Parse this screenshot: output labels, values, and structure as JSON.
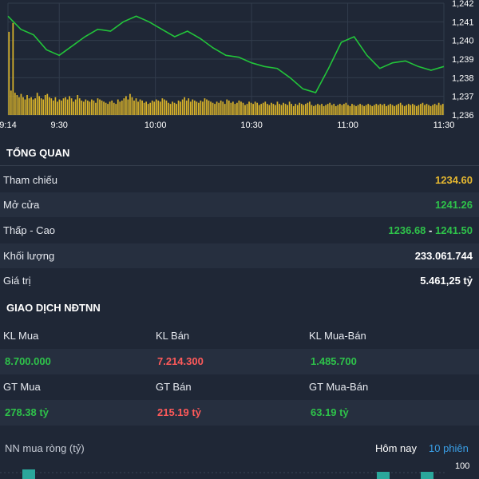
{
  "chart_data": {
    "type": "line+bar",
    "x_ticks": [
      "9:14",
      "9:30",
      "10:00",
      "10:30",
      "11:00",
      "11:30"
    ],
    "y_ticks": [
      "1,242",
      "1,241",
      "1,240",
      "1,239",
      "1,238",
      "1,237",
      "1,236"
    ],
    "ylim": [
      1236,
      1242
    ],
    "price_series": {
      "color": "#22c43a",
      "x_minutes": [
        0,
        4,
        8,
        12,
        16,
        20,
        24,
        28,
        32,
        36,
        40,
        44,
        48,
        52,
        56,
        60,
        64,
        68,
        72,
        76,
        80,
        84,
        88,
        92,
        96,
        100,
        104,
        108,
        112,
        116,
        120,
        124,
        128,
        132,
        136
      ],
      "values": [
        1241.3,
        1240.6,
        1240.3,
        1239.5,
        1239.2,
        1239.7,
        1240.2,
        1240.6,
        1240.5,
        1241.0,
        1241.3,
        1241.0,
        1240.6,
        1240.2,
        1240.5,
        1240.1,
        1239.6,
        1239.2,
        1239.1,
        1238.8,
        1238.6,
        1238.5,
        1238.0,
        1237.4,
        1237.2,
        1238.5,
        1239.9,
        1240.2,
        1239.2,
        1238.5,
        1238.8,
        1238.9,
        1238.6,
        1238.4,
        1238.6
      ]
    },
    "volume_series": {
      "color": "#d9b32a",
      "bars": [
        7.5,
        2.2,
        8.3,
        2.0,
        1.8,
        1.6,
        1.9,
        1.6,
        1.4,
        1.8,
        1.5,
        1.6,
        1.4,
        1.5,
        2.0,
        1.7,
        1.5,
        1.4,
        1.8,
        1.9,
        1.6,
        1.5,
        1.3,
        1.6,
        1.2,
        1.4,
        1.3,
        1.5,
        1.6,
        1.4,
        1.7,
        1.5,
        1.2,
        1.4,
        1.8,
        1.5,
        1.3,
        1.2,
        1.4,
        1.3,
        1.2,
        1.4,
        1.3,
        1.1,
        1.5,
        1.4,
        1.3,
        1.2,
        1.1,
        1.0,
        1.2,
        1.3,
        1.1,
        1.0,
        1.4,
        1.2,
        1.3,
        1.5,
        1.7,
        1.4,
        1.9,
        1.6,
        1.3,
        1.5,
        1.2,
        1.4,
        1.3,
        1.1,
        1.2,
        1.0,
        1.1,
        1.3,
        1.2,
        1.4,
        1.3,
        1.2,
        1.5,
        1.4,
        1.3,
        1.1,
        1.0,
        1.2,
        1.1,
        1.0,
        1.3,
        1.2,
        1.4,
        1.6,
        1.3,
        1.5,
        1.2,
        1.4,
        1.3,
        1.2,
        1.1,
        1.3,
        1.2,
        1.5,
        1.4,
        1.3,
        1.2,
        1.1,
        1.0,
        1.2,
        1.1,
        1.3,
        1.2,
        1.0,
        1.4,
        1.3,
        1.1,
        1.2,
        1.0,
        1.1,
        1.3,
        1.2,
        1.1,
        0.9,
        1.0,
        1.2,
        1.1,
        1.0,
        1.2,
        1.1,
        0.9,
        1.0,
        1.1,
        1.2,
        1.0,
        0.9,
        1.1,
        1.0,
        0.9,
        1.2,
        1.0,
        0.9,
        1.1,
        1.0,
        0.9,
        1.2,
        1.0,
        0.8,
        1.0,
        0.9,
        1.1,
        1.0,
        0.9,
        1.0,
        1.1,
        1.2,
        0.9,
        0.8,
        0.9,
        1.0,
        0.9,
        1.0,
        0.8,
        0.9,
        1.0,
        1.1,
        0.9,
        1.0,
        0.8,
        0.9,
        1.0,
        0.9,
        1.0,
        1.1,
        0.9,
        0.8,
        1.0,
        0.9,
        0.8,
        0.9,
        1.0,
        0.9,
        0.8,
        0.9,
        1.0,
        0.9,
        0.8,
        0.9,
        1.0,
        0.9,
        1.0,
        0.9,
        1.0,
        0.8,
        0.9,
        1.0,
        0.9,
        0.8,
        0.9,
        1.0,
        1.1,
        0.9,
        0.8,
        0.9,
        1.0,
        0.9,
        1.0,
        0.9,
        0.8,
        0.9,
        1.0,
        1.1,
        0.9,
        1.0,
        0.9,
        0.8,
        0.9,
        1.0,
        0.9,
        1.1,
        0.9,
        1.0
      ]
    }
  },
  "tong_quan": {
    "title": "TỔNG QUAN",
    "rows": [
      {
        "label": "Tham chiếu",
        "value": "1234.60",
        "color": "gold"
      },
      {
        "label": "Mở cửa",
        "value": "1241.26",
        "color": "green"
      },
      {
        "label": "Thấp - Cao",
        "value_low": "1236.68",
        "sep": "-",
        "value_high": "1241.50",
        "color": "green"
      },
      {
        "label": "Khối lượng",
        "value": "233.061.744",
        "color": "white"
      },
      {
        "label": "Giá trị",
        "value": "5.461,25 tỷ",
        "color": "white"
      }
    ]
  },
  "foreign": {
    "title": "GIAO DỊCH NĐTNN",
    "kl_mua_label": "KL Mua",
    "kl_mua": "8.700.000",
    "kl_ban_label": "KL Bán",
    "kl_ban": "7.214.300",
    "kl_muaban_label": "KL Mua-Bán",
    "kl_muaban": "1.485.700",
    "gt_mua_label": "GT Mua",
    "gt_mua": "278.38 tỷ",
    "gt_ban_label": "GT Bán",
    "gt_ban": "215.19 tỷ",
    "gt_muaban_label": "GT Mua-Bán",
    "gt_muaban": "63.19 tỷ"
  },
  "nn": {
    "title": "NN mua ròng (tỷ)",
    "tab_today": "Hôm nay",
    "tab_10": "10 phiên",
    "y_top": "100"
  }
}
